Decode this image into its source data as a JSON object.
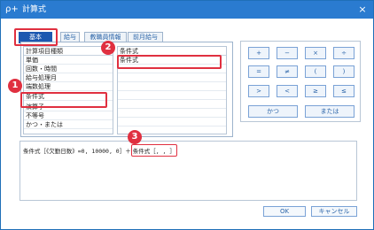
{
  "window": {
    "title": "計算式",
    "title_icon": "ρ+",
    "close_glyph": "×"
  },
  "tabs": [
    {
      "label": "基本",
      "active": true
    },
    {
      "label": "給与",
      "active": false
    },
    {
      "label": "教職員情報",
      "active": false
    },
    {
      "label": "前月給与",
      "active": false
    }
  ],
  "list": {
    "header": "計算項目種類",
    "items": [
      "単価",
      "回数・時間",
      "給与処理月",
      "端数処理",
      "条件式",
      "演算子",
      "不等号",
      "かつ・または"
    ]
  },
  "conditions": {
    "header": "条件式",
    "items": [
      "条件式"
    ]
  },
  "operators": {
    "row1": [
      "+",
      "−",
      "×",
      "÷"
    ],
    "row2": [
      "=",
      "≠",
      "(",
      ")"
    ],
    "row3": [
      ">",
      "<",
      "≥",
      "≤"
    ],
    "wide": [
      "かつ",
      "または"
    ]
  },
  "formula": {
    "prefix": "条件式［《欠勤日数》=0, 10000, 0］＋",
    "highlight": "条件式［, , ］"
  },
  "buttons": {
    "ok": "OK",
    "cancel": "キャンセル"
  },
  "callouts": [
    "1",
    "2",
    "3"
  ],
  "colors": {
    "titlebar": "#2a7bd0",
    "active_tab": "#1d58b0",
    "callout": "#e03040"
  }
}
